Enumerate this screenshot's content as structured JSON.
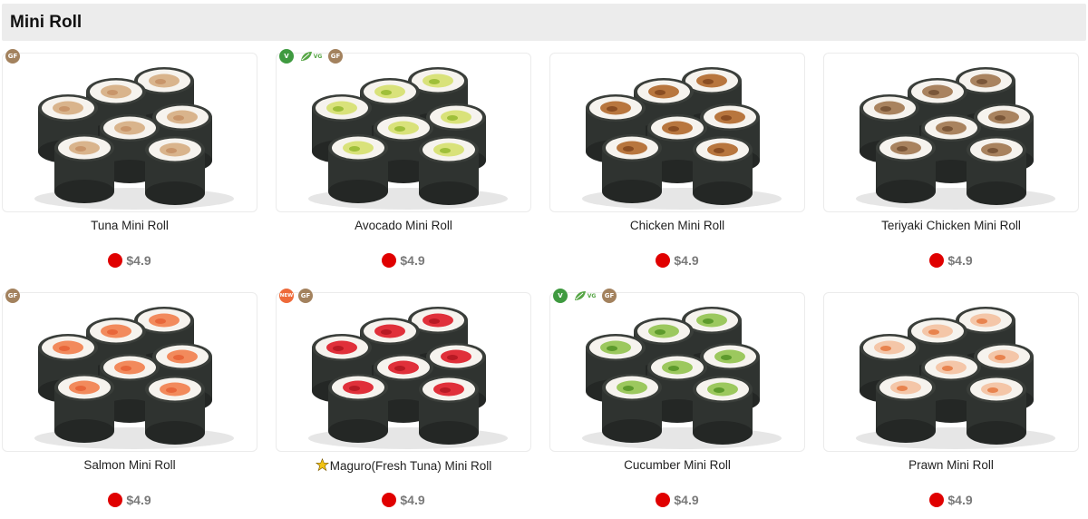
{
  "section": {
    "title": "Mini Roll"
  },
  "colors": {
    "price_dot": "#e00000",
    "gf_badge": "#a3825e",
    "v_badge": "#3f9a40",
    "new_badge": "#ee6a3a",
    "vg_leaf": "#55a544"
  },
  "items": [
    {
      "name": "Tuna Mini Roll",
      "price": "$4.9",
      "badges": [
        "GF"
      ],
      "filling": "tuna"
    },
    {
      "name": "Avocado Mini Roll",
      "price": "$4.9",
      "badges": [
        "V",
        "VG",
        "GF"
      ],
      "filling": "avocado"
    },
    {
      "name": "Chicken Mini Roll",
      "price": "$4.9",
      "badges": [],
      "filling": "chicken"
    },
    {
      "name": "Teriyaki Chicken Mini Roll",
      "price": "$4.9",
      "badges": [],
      "filling": "teriyaki"
    },
    {
      "name": "Salmon Mini Roll",
      "price": "$4.9",
      "badges": [
        "GF"
      ],
      "filling": "salmon"
    },
    {
      "name": "Maguro(Fresh Tuna) Mini Roll",
      "price": "$4.9",
      "badges": [
        "NEW",
        "GF"
      ],
      "filling": "maguro",
      "star_icon": "new-star-icon"
    },
    {
      "name": "Cucumber Mini Roll",
      "price": "$4.9",
      "badges": [
        "V",
        "VG",
        "GF"
      ],
      "filling": "cucumber"
    },
    {
      "name": "Prawn Mini Roll",
      "price": "$4.9",
      "badges": [],
      "filling": "prawn"
    }
  ]
}
